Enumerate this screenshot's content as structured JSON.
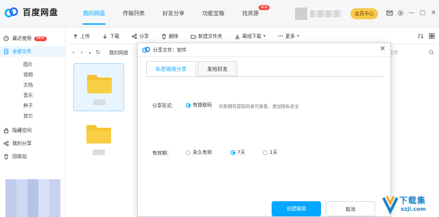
{
  "app": {
    "name": "百度网盘",
    "colors": {
      "accent": "#06a7ff",
      "folder": "#f6c431",
      "badge": "#f5423b",
      "vip": "#f8c84a"
    }
  },
  "top_nav": {
    "items": [
      {
        "label": "我的网盘",
        "active": true
      },
      {
        "label": "传输列表"
      },
      {
        "label": "好友分享"
      },
      {
        "label": "功能宝箱"
      },
      {
        "label": "找资源",
        "badge": "NEW"
      }
    ],
    "vip_label": "会员中心",
    "icons": [
      "mail-icon",
      "settings-icon",
      "minimize-icon",
      "maximize-icon",
      "close-icon"
    ]
  },
  "sidebar": {
    "items": [
      {
        "label": "最近使用",
        "badge": "NEW",
        "icon": "clock-icon"
      },
      {
        "label": "全部文件",
        "icon": "file-icon",
        "active": true
      }
    ],
    "sub_items": [
      "图片",
      "视频",
      "文档",
      "音乐",
      "种子",
      "其它"
    ],
    "bottom_items": [
      {
        "label": "隐藏空间",
        "icon": "lock-icon"
      },
      {
        "label": "我的分享",
        "icon": "share-icon"
      },
      {
        "label": "回收站",
        "icon": "trash-icon"
      }
    ]
  },
  "toolbar": {
    "buttons": [
      {
        "label": "上传",
        "icon": "upload-icon"
      },
      {
        "label": "下载",
        "icon": "download-icon"
      },
      {
        "label": "分享",
        "icon": "share-icon"
      },
      {
        "label": "删除",
        "icon": "delete-icon"
      },
      {
        "label": "新建文件夹",
        "icon": "new-folder-icon"
      },
      {
        "label": "离线下载",
        "icon": "offline-download-icon",
        "dropdown": true
      },
      {
        "label": "更多",
        "icon": "more-icon",
        "dropdown": true
      }
    ]
  },
  "path_bar": {
    "path": "我的网盘",
    "search_hint": "文件"
  },
  "dialog": {
    "title": "分享文件：软件",
    "tabs": [
      {
        "label": "私密链接分享",
        "active": true
      },
      {
        "label": "发给好友"
      }
    ],
    "share_form": {
      "label": "分享形式：",
      "option": "有提取码",
      "selected": true,
      "hint": "仅限拥有提取码者可查看，更加隐私安全"
    },
    "validity": {
      "label": "有效期：",
      "options": [
        {
          "label": "永久有效",
          "selected": false
        },
        {
          "label": "7天",
          "selected": true
        },
        {
          "label": "1天",
          "selected": false
        }
      ]
    },
    "create_button": "创建链接",
    "cancel_button": "取消"
  },
  "watermark": {
    "text": "下载集",
    "url": "xzji.com"
  }
}
